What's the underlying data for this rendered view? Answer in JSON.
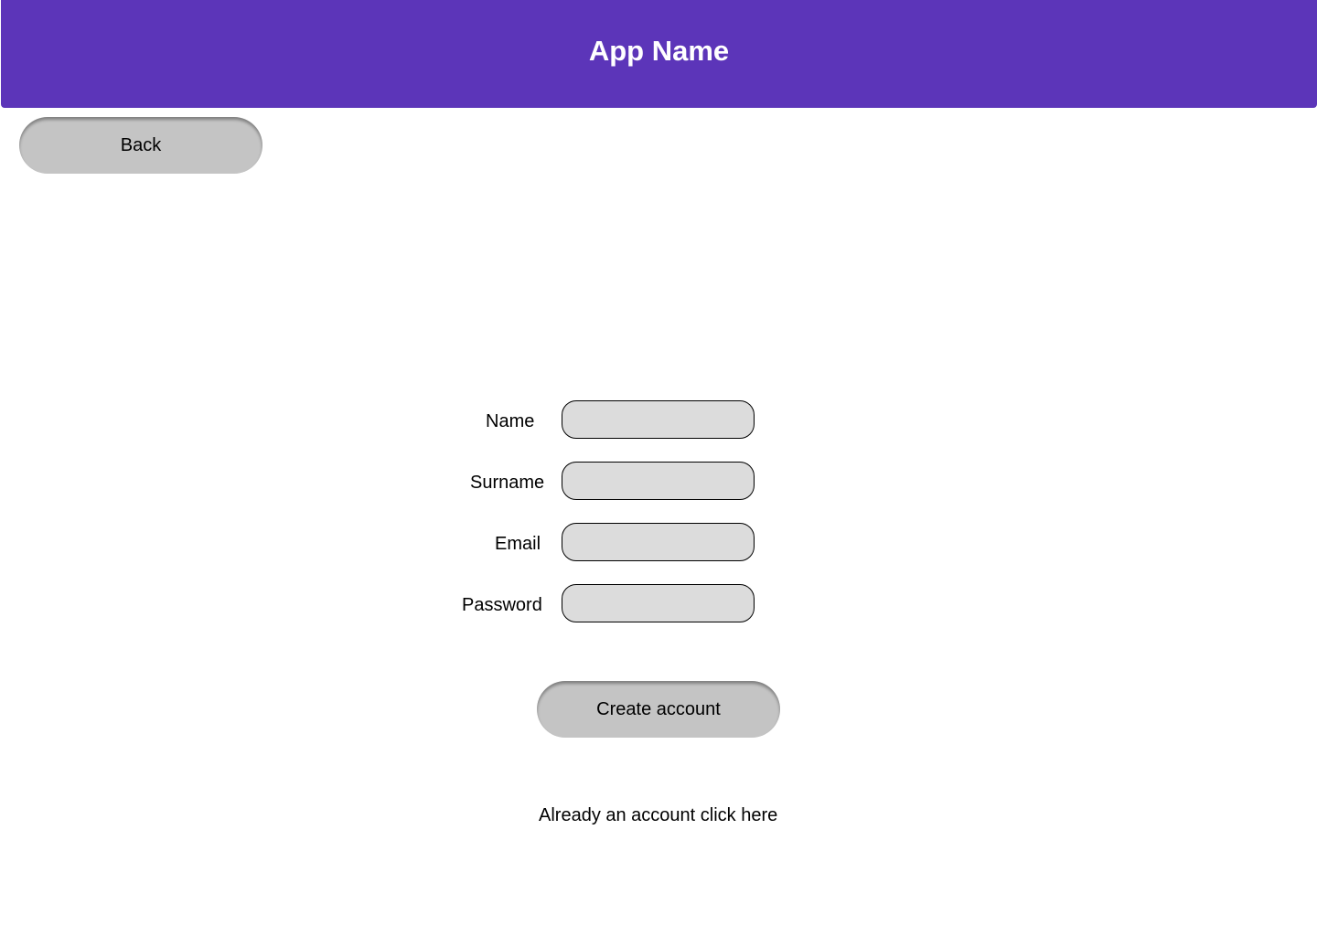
{
  "header": {
    "title": "App Name",
    "color": "#5c35b9"
  },
  "back_label": "Back",
  "form": {
    "fields": [
      {
        "label": "Name",
        "value": ""
      },
      {
        "label": "Surname",
        "value": ""
      },
      {
        "label": "Email",
        "value": ""
      },
      {
        "label": "Password",
        "value": ""
      }
    ],
    "submit_label": "Create account"
  },
  "login_link": "Already an account click here"
}
